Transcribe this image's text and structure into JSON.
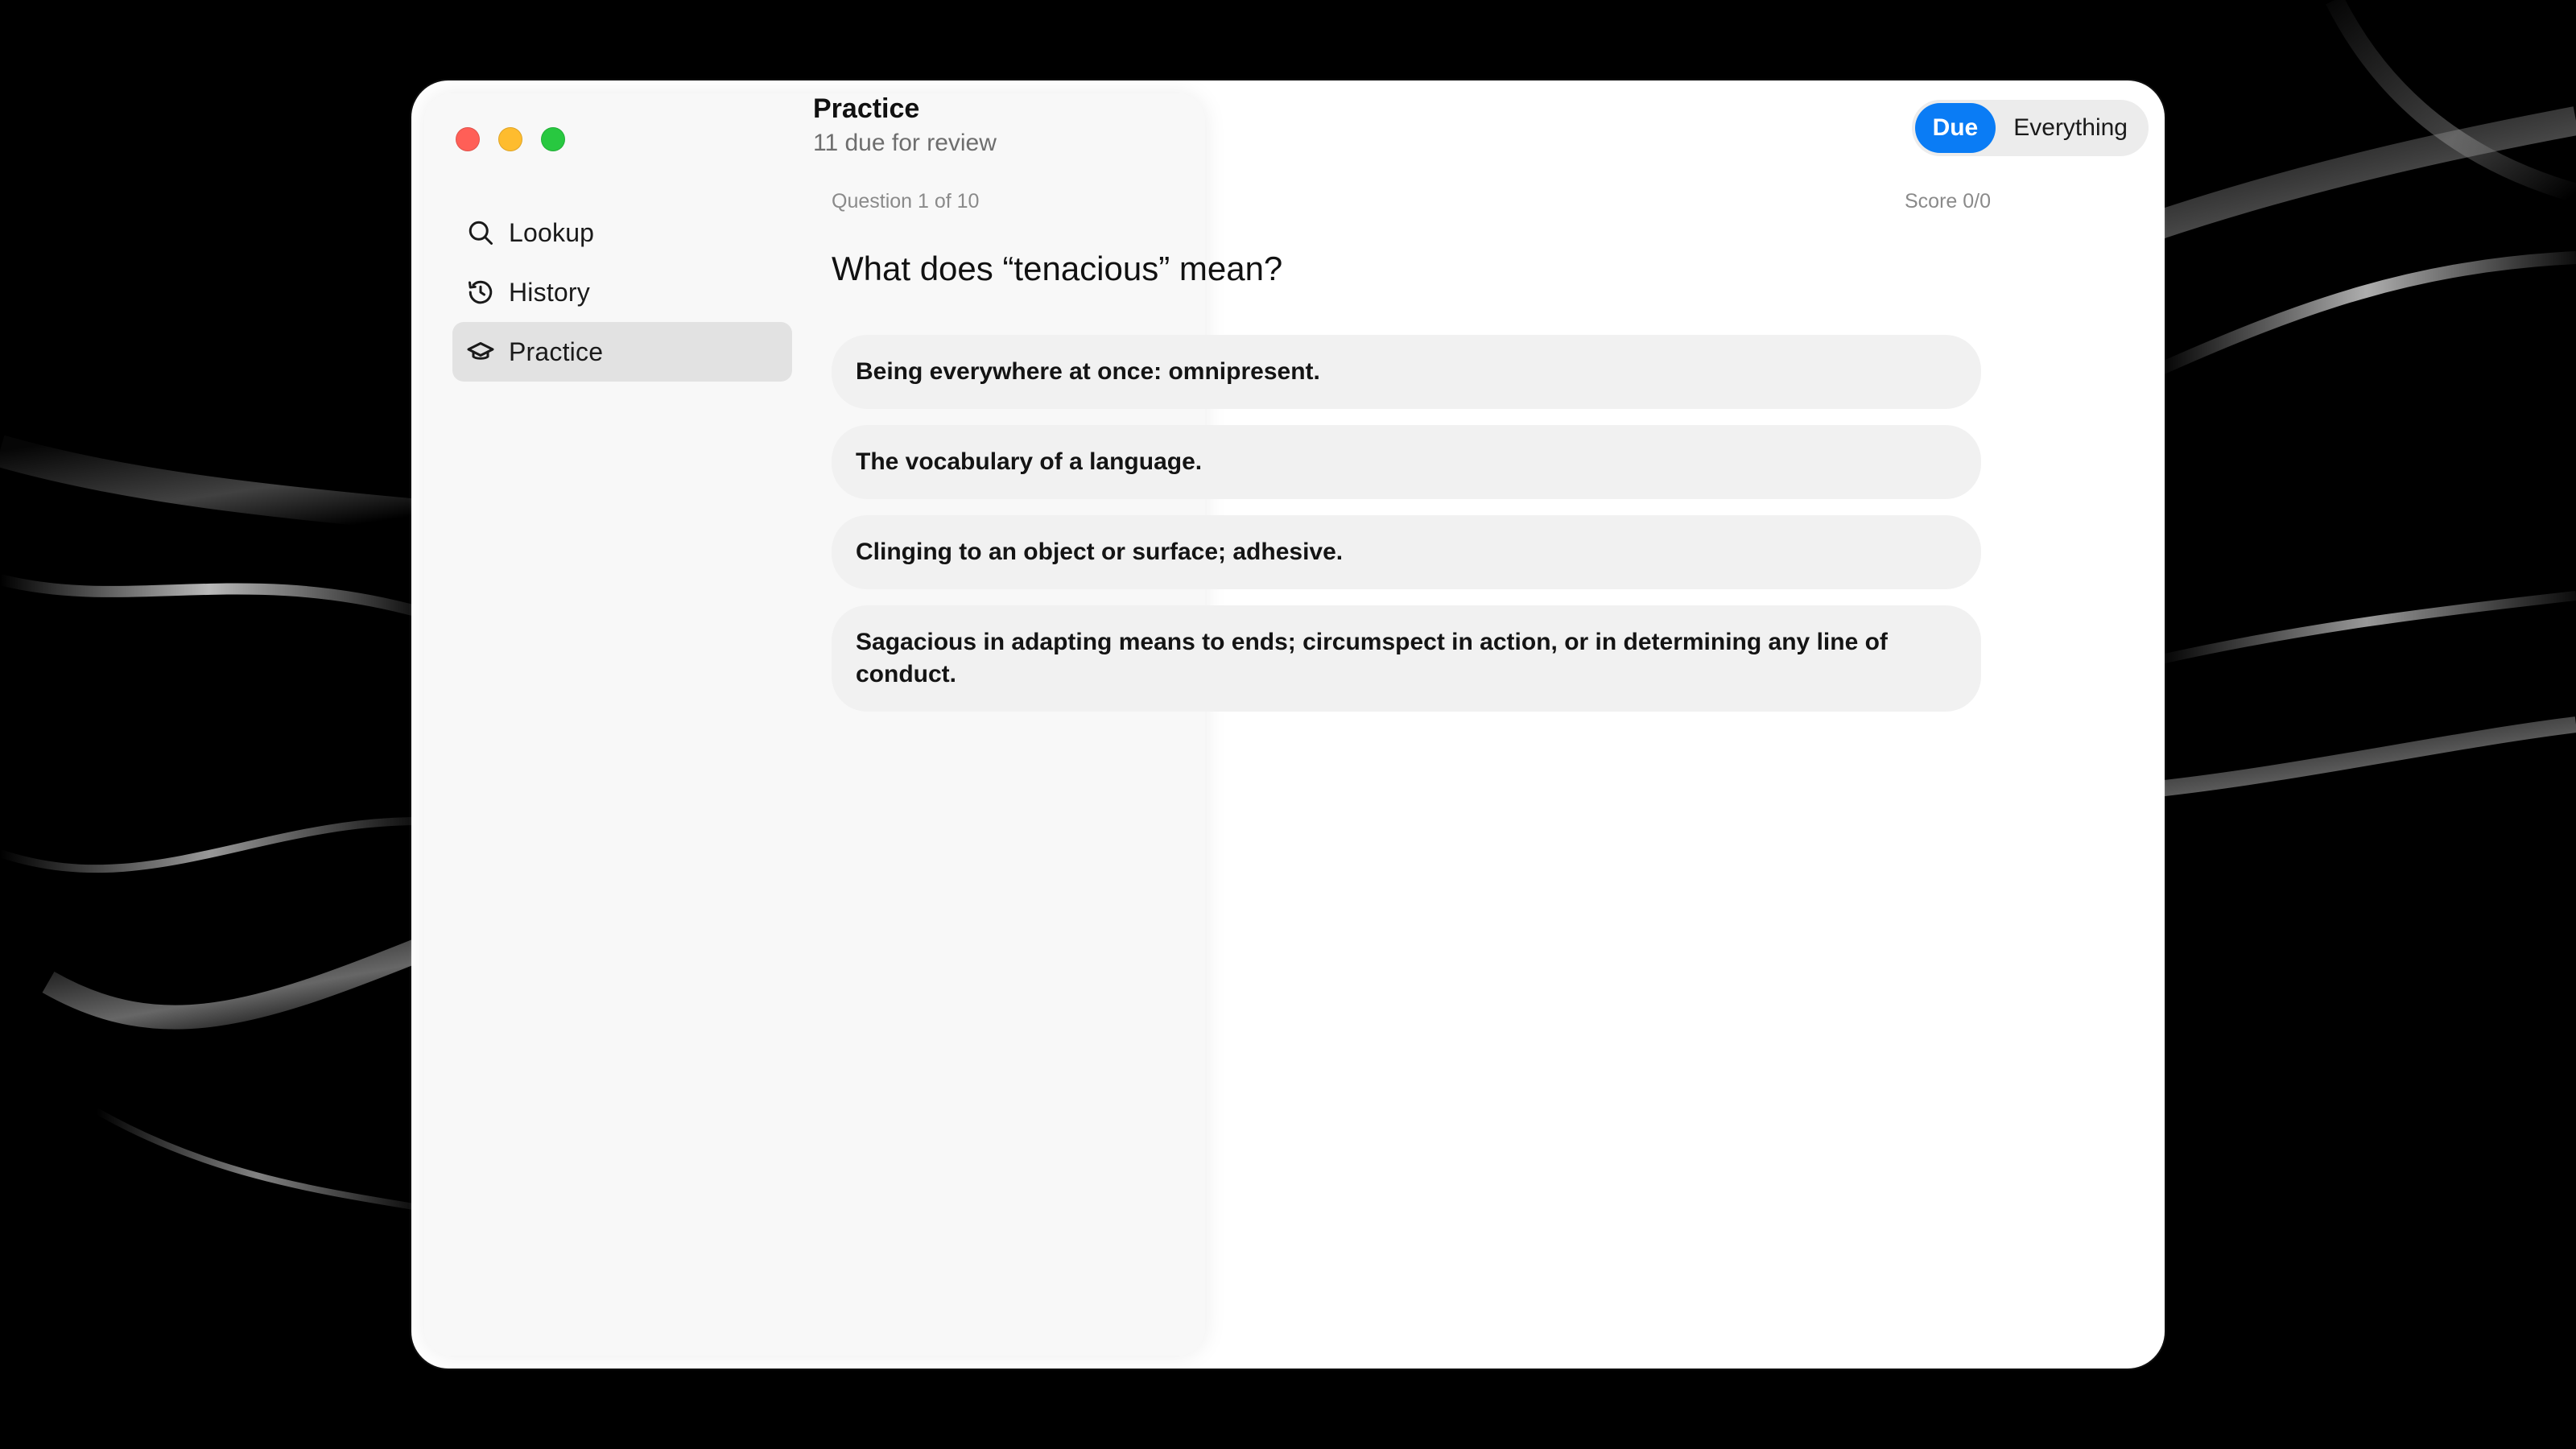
{
  "window": {
    "traffic_lights": [
      "close",
      "minimize",
      "zoom"
    ]
  },
  "sidebar": {
    "items": [
      {
        "label": "Lookup",
        "icon": "search-icon",
        "active": false
      },
      {
        "label": "History",
        "icon": "history-icon",
        "active": false
      },
      {
        "label": "Practice",
        "icon": "graduation-cap-icon",
        "active": true
      }
    ]
  },
  "header": {
    "title": "Practice",
    "subtitle": "11 due for review",
    "segments": [
      {
        "label": "Due",
        "active": true
      },
      {
        "label": "Everything",
        "active": false
      }
    ]
  },
  "quiz": {
    "progress": "Question 1 of 10",
    "score": "Score 0/0",
    "question": "What does “tenacious” mean?",
    "options": [
      "Being everywhere at once: omnipresent.",
      "The vocabulary of a language.",
      "Clinging to an object or surface; adhesive.",
      "Sagacious in adapting means to ends; circumspect in action, or in determining any line of conduct."
    ]
  },
  "colors": {
    "accent": "#0a7cf5",
    "traffic_red": "#ff5f57",
    "traffic_yellow": "#febc2e",
    "traffic_green": "#28c840",
    "option_bg": "#f1f1f1",
    "sidebar_bg": "#f8f8f8",
    "active_item_bg": "#e2e2e2"
  }
}
